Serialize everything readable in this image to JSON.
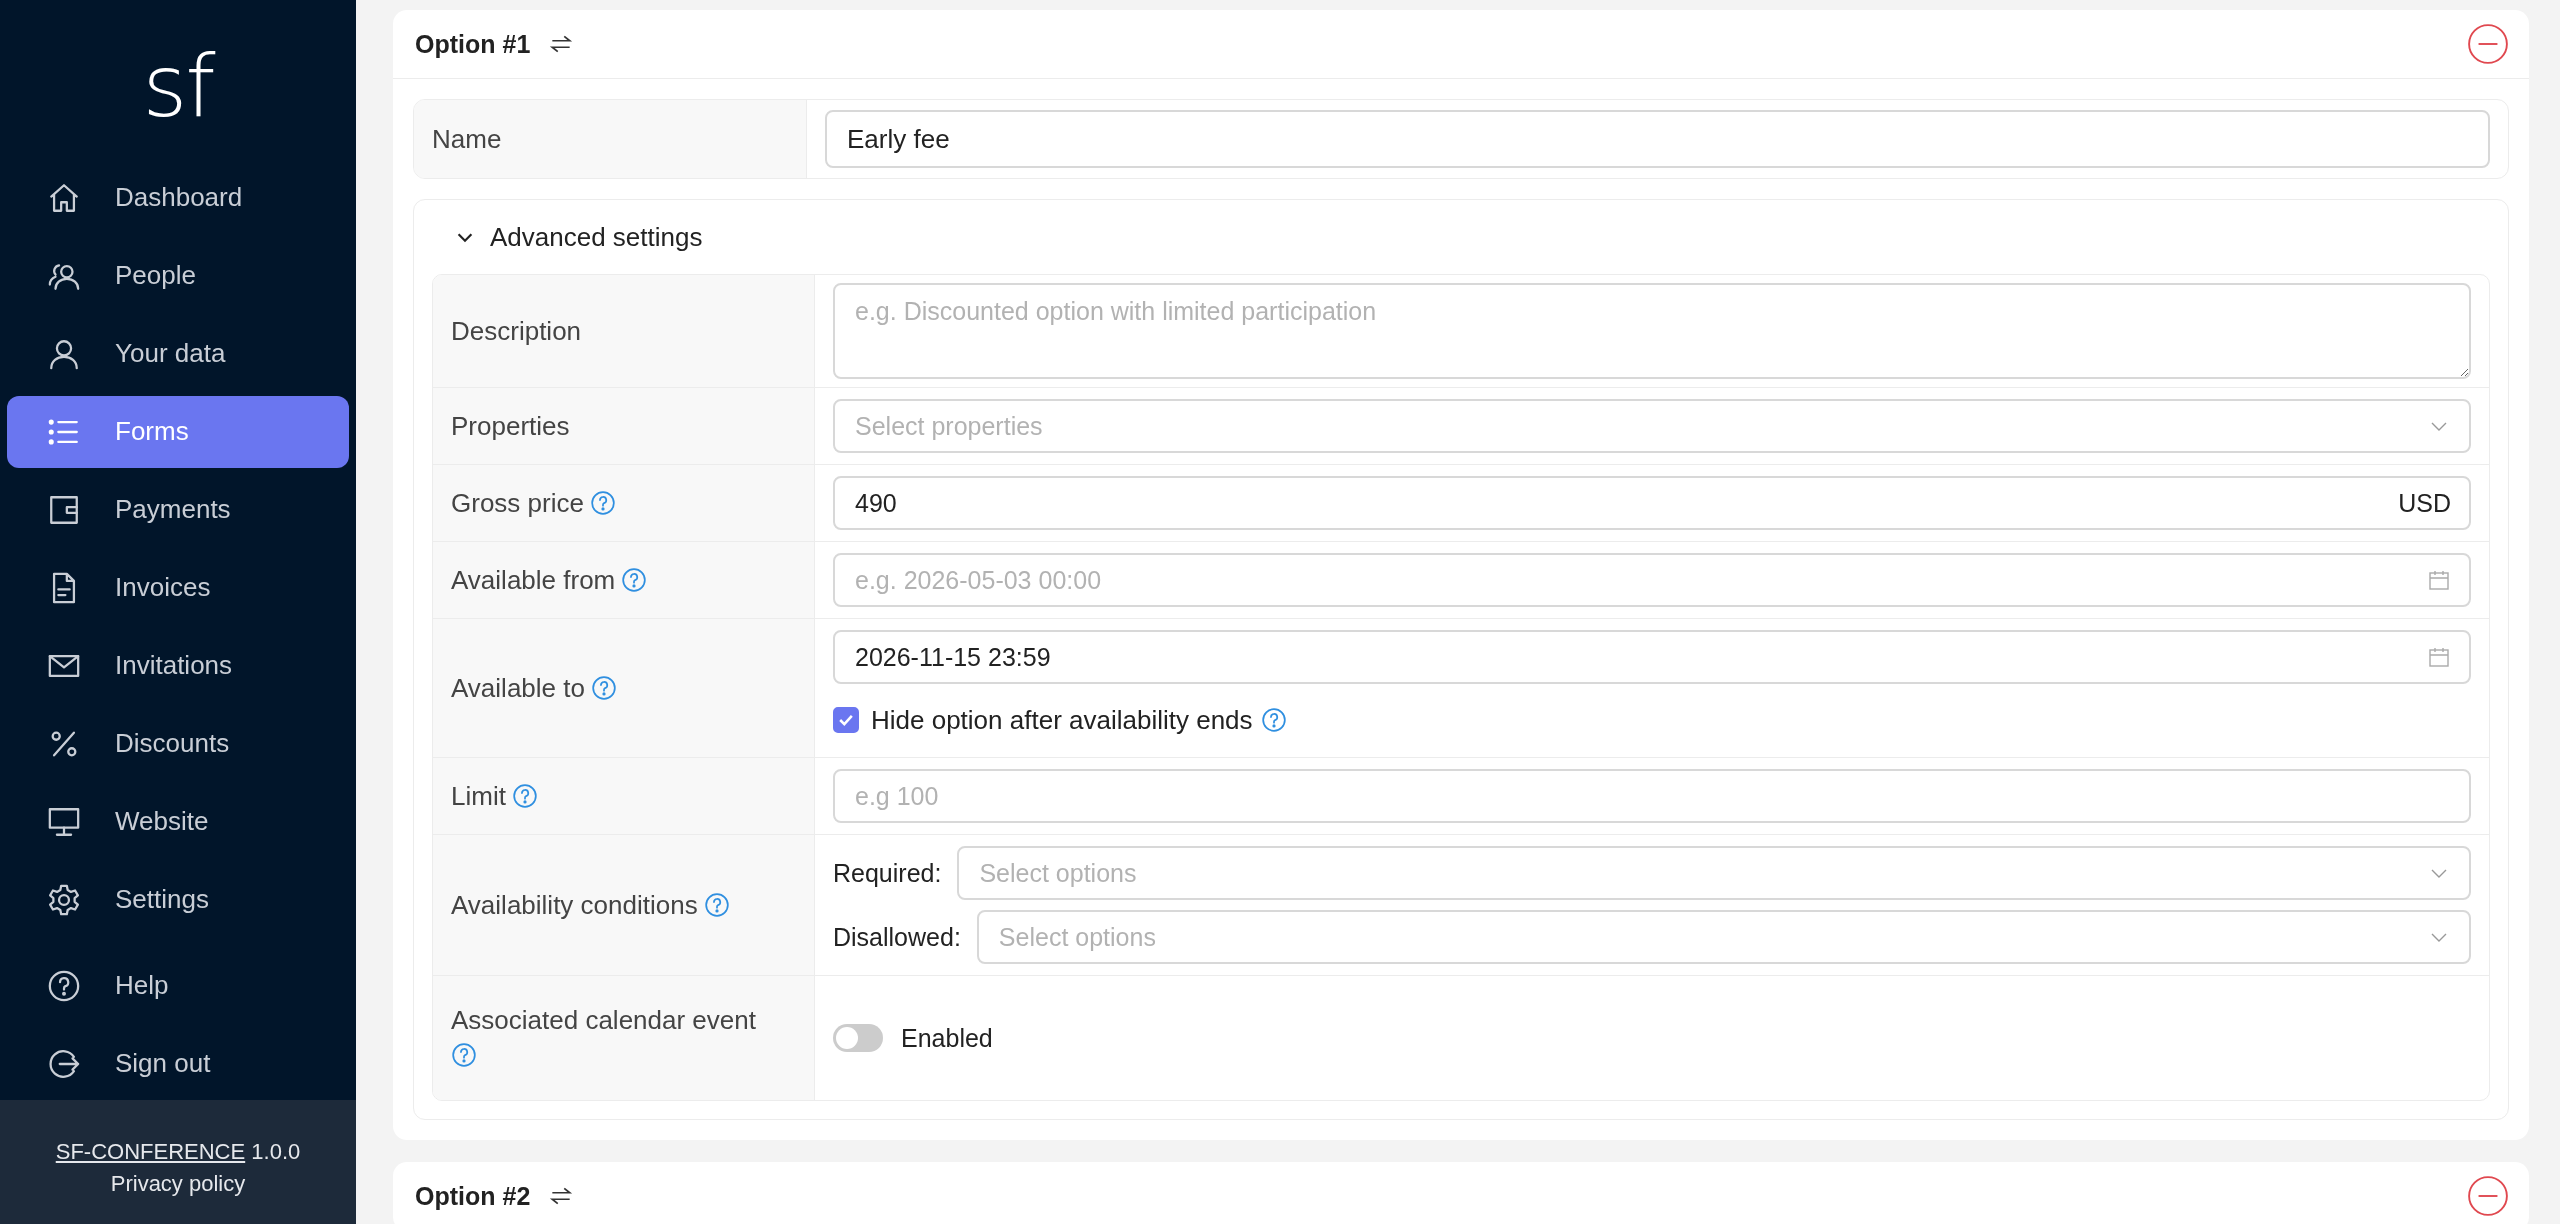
{
  "sidebar": {
    "logo": "sf",
    "items": [
      {
        "kind": "home",
        "label": "Dashboard",
        "selected": false
      },
      {
        "kind": "people",
        "label": "People",
        "selected": false
      },
      {
        "kind": "person",
        "label": "Your data",
        "selected": false
      },
      {
        "kind": "list",
        "label": "Forms",
        "selected": true
      },
      {
        "kind": "wallet",
        "label": "Payments",
        "selected": false
      },
      {
        "kind": "document",
        "label": "Invoices",
        "selected": false
      },
      {
        "kind": "envelope",
        "label": "Invitations",
        "selected": false
      },
      {
        "kind": "percent",
        "label": "Discounts",
        "selected": false
      },
      {
        "kind": "monitor",
        "label": "Website",
        "selected": false
      },
      {
        "kind": "gear",
        "label": "Settings",
        "selected": false
      },
      {
        "kind": "help",
        "label": "Help",
        "selected": false
      },
      {
        "kind": "signout",
        "label": "Sign out",
        "selected": false
      }
    ],
    "footer": {
      "app_link": "SF-CONFERENCE",
      "version": "1.0.0",
      "privacy": "Privacy policy"
    }
  },
  "options": [
    {
      "title": "Option #1",
      "name_label": "Name",
      "name_value": "Early fee",
      "advanced": {
        "label": "Advanced settings",
        "expanded": true,
        "rows": [
          {
            "kind": "textarea",
            "label": "Description",
            "help": false,
            "placeholder": "e.g. Discounted option with limited participation"
          },
          {
            "kind": "select",
            "label": "Properties",
            "help": false,
            "placeholder": "Select properties"
          },
          {
            "kind": "price",
            "label": "Gross price",
            "help": true,
            "value": "490",
            "currency": "USD"
          },
          {
            "kind": "date",
            "label": "Available from",
            "help": true,
            "placeholder": "e.g. 2026-05-03 00:00"
          },
          {
            "kind": "date_check",
            "label": "Available to",
            "help": true,
            "value": "2026-11-15 23:59",
            "checkbox": {
              "label": "Hide option after availability ends",
              "checked": true,
              "help": true
            }
          },
          {
            "kind": "input",
            "label": "Limit",
            "help": true,
            "placeholder": "e.g 100"
          },
          {
            "kind": "conditions",
            "label": "Availability conditions",
            "help": true,
            "fields": [
              {
                "label": "Required:",
                "placeholder": "Select options"
              },
              {
                "label": "Disallowed:",
                "placeholder": "Select options"
              }
            ]
          },
          {
            "kind": "toggle",
            "label": "Associated calendar event",
            "help": true,
            "toggle": {
              "label": "Enabled",
              "on": false
            }
          }
        ]
      }
    },
    {
      "title": "Option #2"
    }
  ]
}
